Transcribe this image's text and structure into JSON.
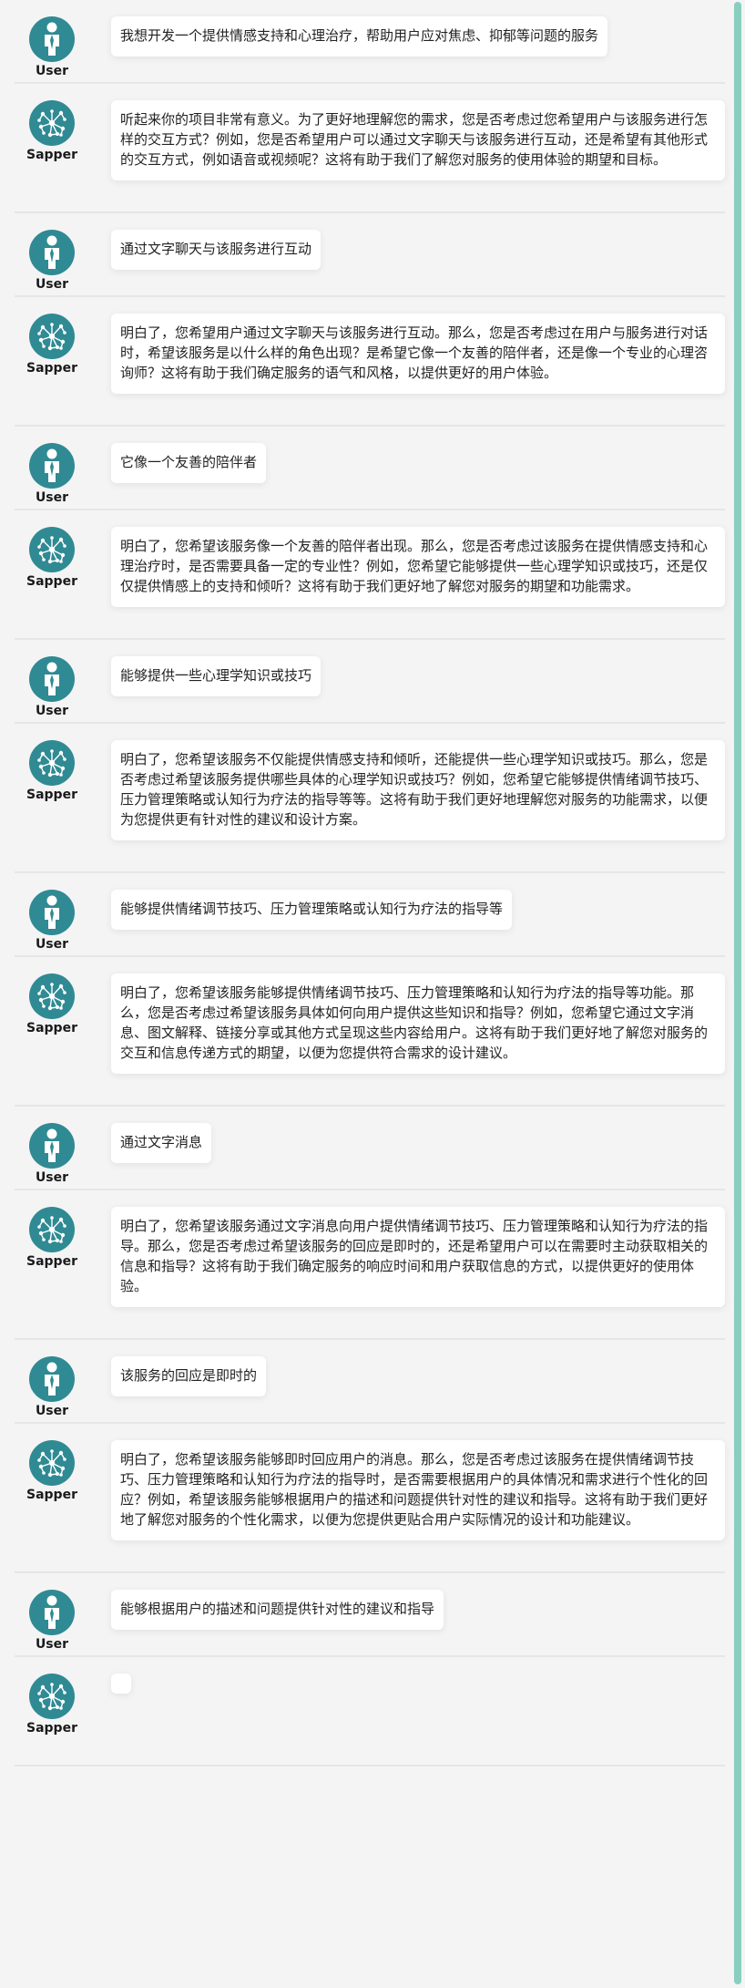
{
  "speakers": {
    "user": "User",
    "bot": "Sapper"
  },
  "messages": [
    {
      "role": "user",
      "text": "我想开发一个提供情感支持和心理治疗，帮助用户应对焦虑、抑郁等问题的服务"
    },
    {
      "role": "bot",
      "text": "听起来你的项目非常有意义。为了更好地理解您的需求，您是否考虑过您希望用户与该服务进行怎样的交互方式？例如，您是否希望用户可以通过文字聊天与该服务进行互动，还是希望有其他形式的交互方式，例如语音或视频呢？这将有助于我们了解您对服务的使用体验的期望和目标。"
    },
    {
      "role": "user",
      "text": "通过文字聊天与该服务进行互动"
    },
    {
      "role": "bot",
      "text": "明白了，您希望用户通过文字聊天与该服务进行互动。那么，您是否考虑过在用户与服务进行对话时，希望该服务是以什么样的角色出现？是希望它像一个友善的陪伴者，还是像一个专业的心理咨询师？这将有助于我们确定服务的语气和风格，以提供更好的用户体验。"
    },
    {
      "role": "user",
      "text": "它像一个友善的陪伴者"
    },
    {
      "role": "bot",
      "text": "明白了，您希望该服务像一个友善的陪伴者出现。那么，您是否考虑过该服务在提供情感支持和心理治疗时，是否需要具备一定的专业性？例如，您希望它能够提供一些心理学知识或技巧，还是仅仅提供情感上的支持和倾听？这将有助于我们更好地了解您对服务的期望和功能需求。"
    },
    {
      "role": "user",
      "text": "能够提供一些心理学知识或技巧"
    },
    {
      "role": "bot",
      "text": "明白了，您希望该服务不仅能提供情感支持和倾听，还能提供一些心理学知识或技巧。那么，您是否考虑过希望该服务提供哪些具体的心理学知识或技巧？例如，您希望它能够提供情绪调节技巧、压力管理策略或认知行为疗法的指导等等。这将有助于我们更好地理解您对服务的功能需求，以便为您提供更有针对性的建议和设计方案。"
    },
    {
      "role": "user",
      "text": "能够提供情绪调节技巧、压力管理策略或认知行为疗法的指导等"
    },
    {
      "role": "bot",
      "text": "明白了，您希望该服务能够提供情绪调节技巧、压力管理策略和认知行为疗法的指导等功能。那么，您是否考虑过希望该服务具体如何向用户提供这些知识和指导？例如，您希望它通过文字消息、图文解释、链接分享或其他方式呈现这些内容给用户。这将有助于我们更好地了解您对服务的交互和信息传递方式的期望，以便为您提供符合需求的设计建议。"
    },
    {
      "role": "user",
      "text": "通过文字消息"
    },
    {
      "role": "bot",
      "text": "明白了，您希望该服务通过文字消息向用户提供情绪调节技巧、压力管理策略和认知行为疗法的指导。那么，您是否考虑过希望该服务的回应是即时的，还是希望用户可以在需要时主动获取相关的信息和指导？这将有助于我们确定服务的响应时间和用户获取信息的方式，以提供更好的使用体验。"
    },
    {
      "role": "user",
      "text": "该服务的回应是即时的"
    },
    {
      "role": "bot",
      "text": "明白了，您希望该服务能够即时回应用户的消息。那么，您是否考虑过该服务在提供情绪调节技巧、压力管理策略和认知行为疗法的指导时，是否需要根据用户的具体情况和需求进行个性化的回应？例如，希望该服务能够根据用户的描述和问题提供针对性的建议和指导。这将有助于我们更好地了解您对服务的个性化需求，以便为您提供更贴合用户实际情况的设计和功能建议。"
    },
    {
      "role": "user",
      "text": "能够根据用户的描述和问题提供针对性的建议和指导"
    },
    {
      "role": "bot",
      "text": ""
    }
  ],
  "icons": {
    "user_avatar": "person-icon",
    "bot_avatar": "neural-network-icon"
  },
  "colors": {
    "avatar_bg": "#2f8a93",
    "scrollbar": "#88cfbf",
    "page_bg": "#f4f4f4"
  }
}
